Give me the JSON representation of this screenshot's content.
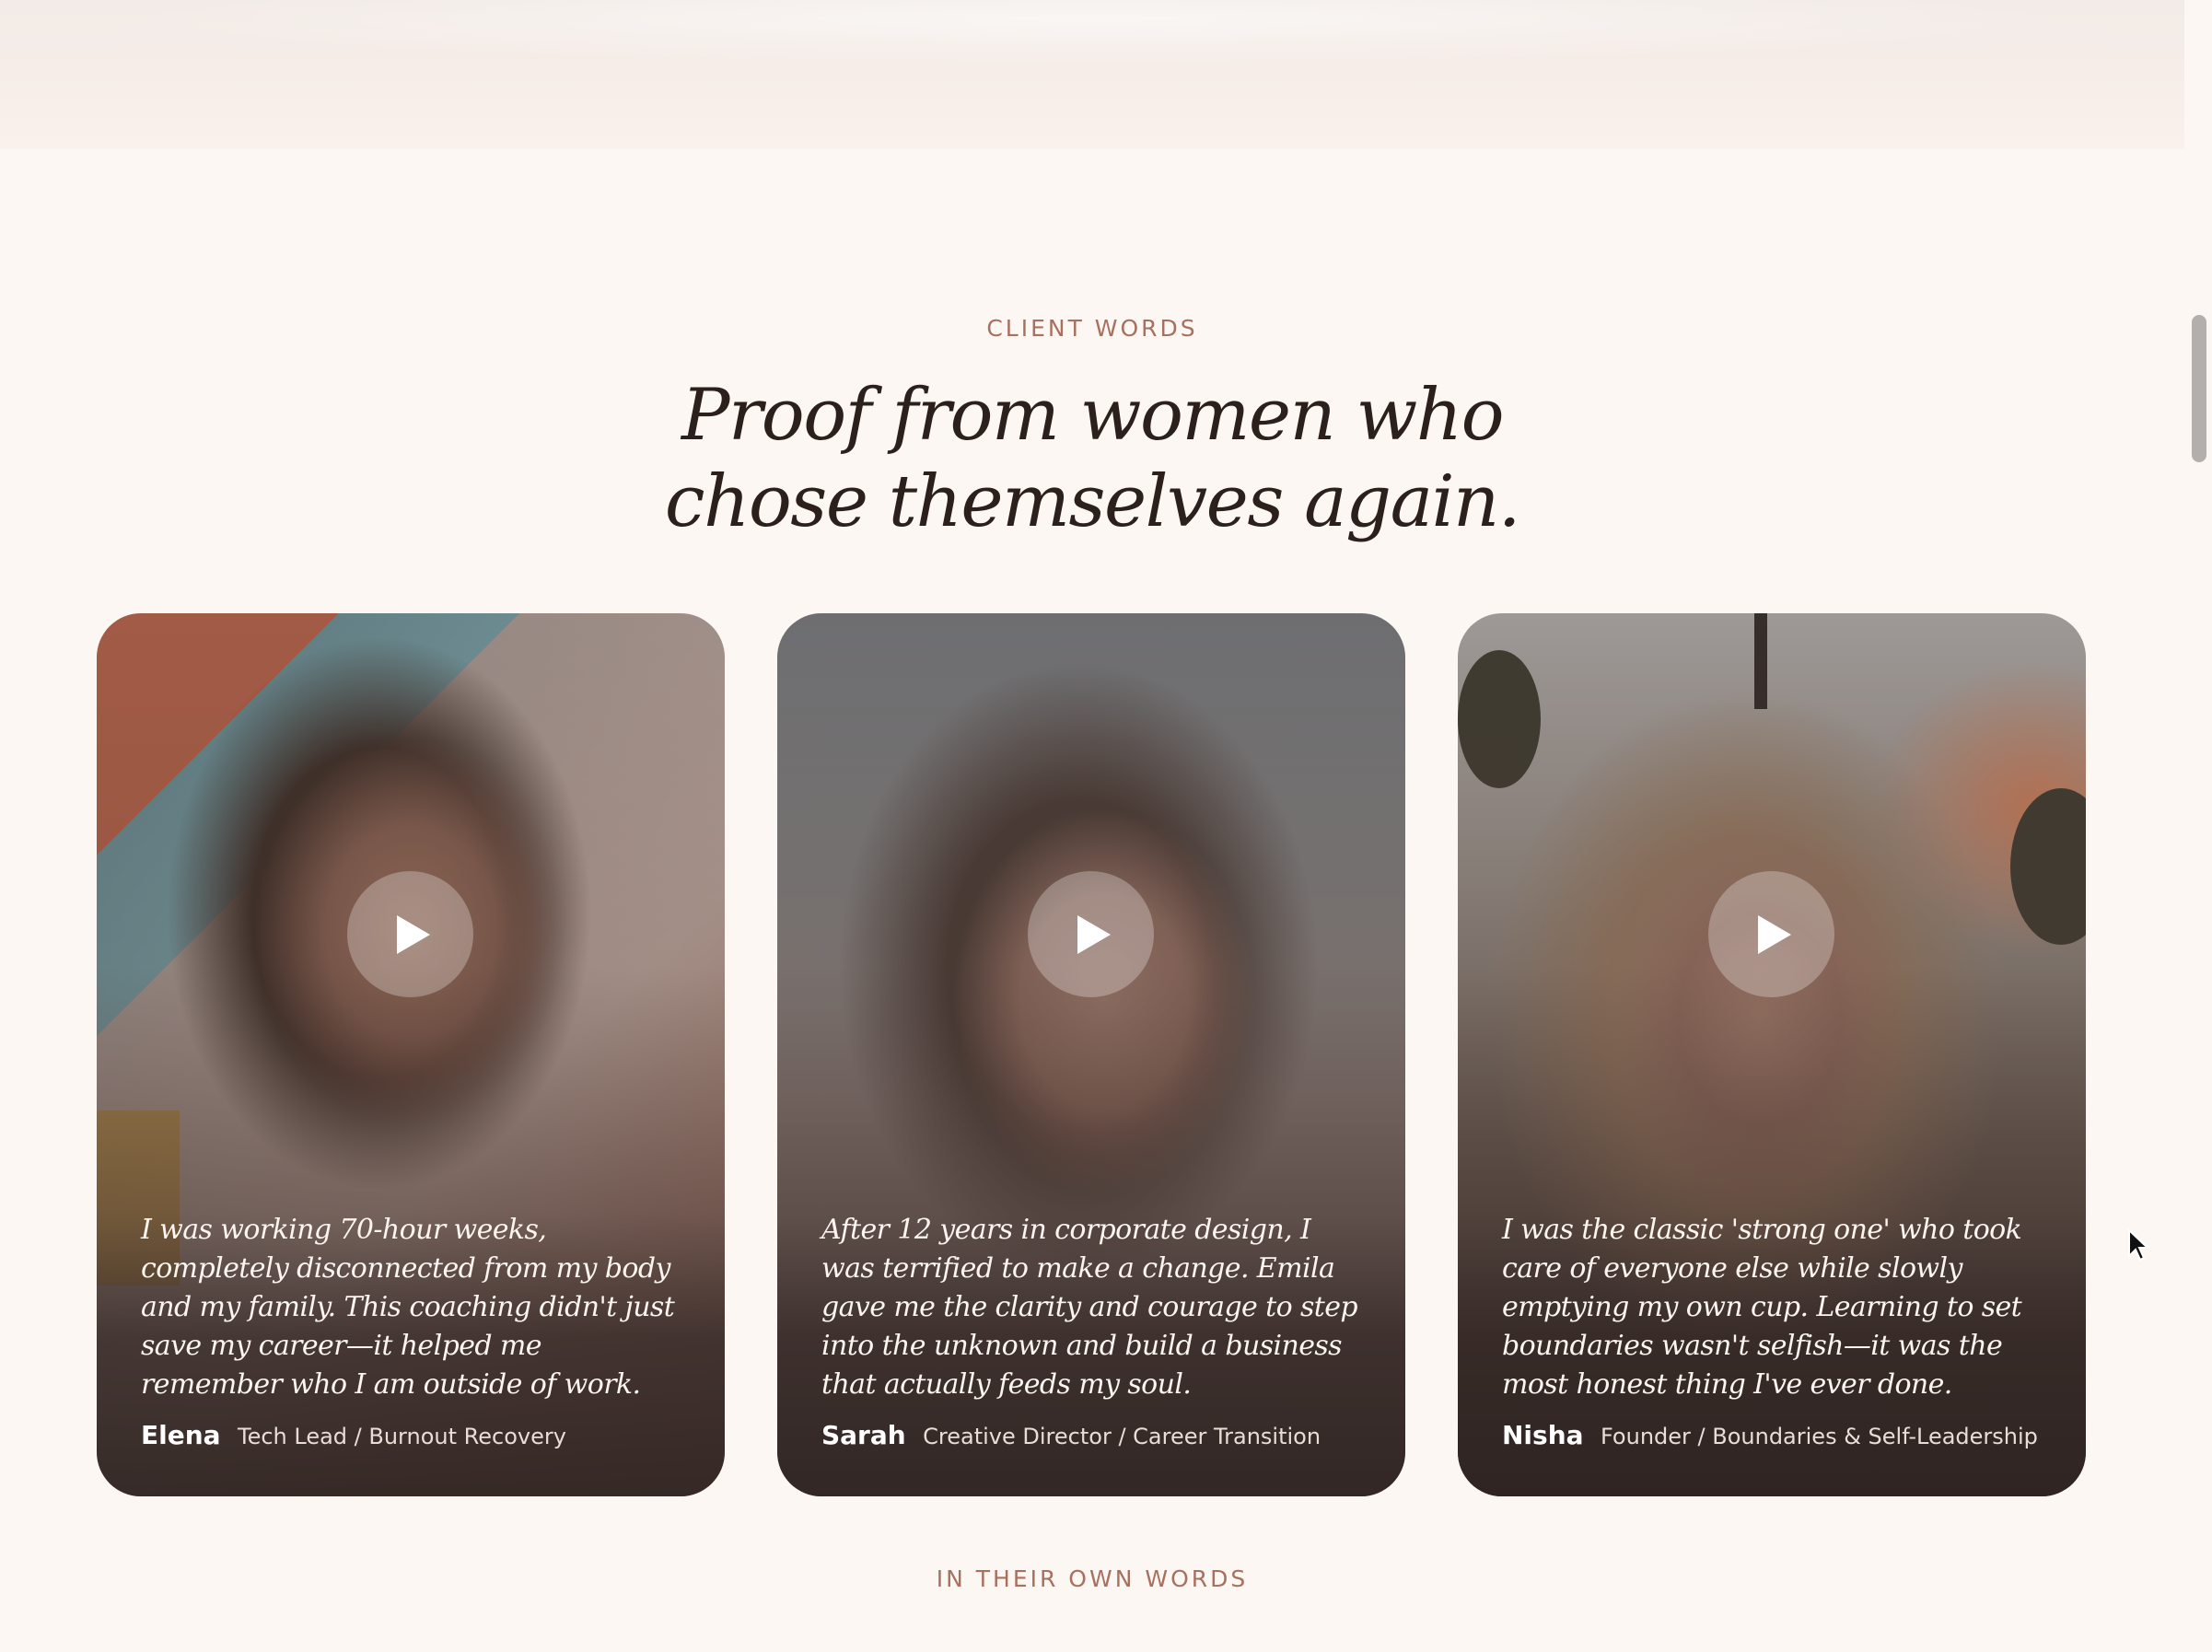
{
  "section": {
    "eyebrow": "CLIENT WORDS",
    "headline_line1": "Proof from women who",
    "headline_line2": "chose themselves again."
  },
  "testimonials": [
    {
      "quote": "I was working 70-hour weeks, completely disconnected from my body and my family. This coaching didn't just save my career—it helped me remember who I am outside of work.",
      "name": "Elena",
      "role": "Tech Lead / Burnout Recovery"
    },
    {
      "quote": "After 12 years in corporate design, I was terrified to make a change. Emila gave me the clarity and courage to step into the unknown and build a business that actually feeds my soul.",
      "name": "Sarah",
      "role": "Creative Director / Career Transition"
    },
    {
      "quote": "I was the classic 'strong one' who took care of everyone else while slowly emptying my own cup. Learning to set boundaries wasn't selfish—it was the most honest thing I've ever done.",
      "name": "Nisha",
      "role": "Founder / Boundaries & Self-Leadership"
    }
  ],
  "next_section": {
    "eyebrow": "IN THEIR OWN WORDS"
  },
  "icons": {
    "play": "play-icon",
    "cursor": "cursor-arrow-icon"
  },
  "colors": {
    "page_background": "#fcf7f3",
    "eyebrow": "#a8705f",
    "headline": "#2b201c",
    "quote_text": "#fbf4ef"
  }
}
